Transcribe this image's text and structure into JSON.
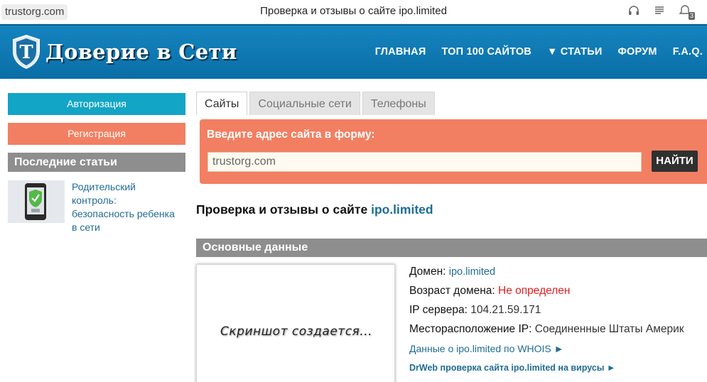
{
  "browser": {
    "url": "trustorg.com",
    "tab_title": "Проверка и отзывы о сайте ipo.limited",
    "notification_count": "3"
  },
  "header": {
    "logo_text": "Доверие в Сети",
    "logo_letter": "T",
    "nav": [
      "ГЛАВНАЯ",
      "ТОП 100 САЙТОВ",
      "▼ СТАТЬИ",
      "ФОРУМ",
      "F.A.Q."
    ]
  },
  "sidebar": {
    "auth_label": "Авторизация",
    "register_label": "Регистрация",
    "articles_heading": "Последние статьи",
    "article_title_lines": [
      "Родительский",
      "контроль:",
      "безопасность ребенка",
      "в сети"
    ]
  },
  "main": {
    "tabs": [
      "Сайты",
      "Социальные сети",
      "Телефоны"
    ],
    "search_label": "Введите адрес сайта в форму:",
    "search_value": "trustorg.com",
    "search_button": "НАЙТИ",
    "heading_prefix": "Проверка и отзывы о сайте ",
    "heading_domain": "ipo.limited",
    "section_title": "Основные данные",
    "screenshot_text": "Скриншот создается...",
    "info": {
      "domain_label": "Домен:",
      "domain_value": "ipo.limited",
      "age_label": "Возраст домена:",
      "age_value": "Не определен",
      "ip_label": "IP сервера:",
      "ip_value": "104.21.59.171",
      "location_label": "Месторасположение IP:",
      "location_value": "Соединенные Штаты Америк",
      "whois_link": "Данные о ipo.limited по WHOIS ►",
      "drweb_link": "DrWeb проверка сайта ipo.limited на вирусы ►"
    }
  },
  "colors": {
    "header_blue": "#1584bf",
    "auth_button": "#13a5c5",
    "register_button": "#f27f62",
    "section_gray": "#8e8e8e",
    "link_blue": "#1f6c95",
    "warning_red": "#e02020"
  }
}
